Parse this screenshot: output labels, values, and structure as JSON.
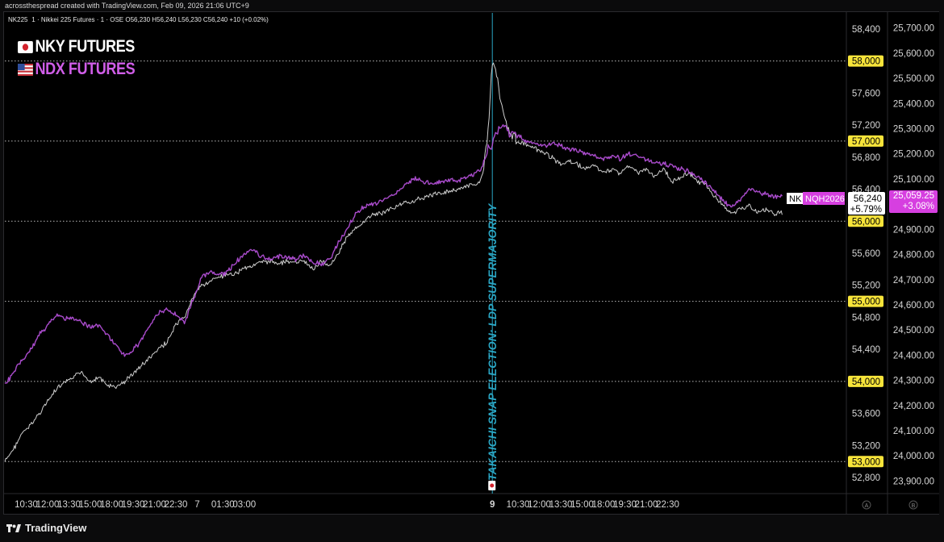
{
  "credit": "acrossthespread created with TradingView.com, Feb 09, 2026 21:06 UTC+9",
  "symbol_line": "NK2251 · Nikkei 225 Futures · 1 · OSE  O56,230  H56,240  L56,230  C56,240  +10 (+0.02%)",
  "legend": {
    "nky": "NKY FUTURES",
    "ndx": "NDX FUTURES"
  },
  "brand": "TradingView",
  "colors": {
    "nky": "#d8d8d8",
    "ndx": "#b24fd6",
    "label_yellow": "#f7e43a",
    "event_line": "#2aa6c4",
    "pink_badge": "#d63fe0"
  },
  "chart_data": {
    "type": "line",
    "title": "",
    "x_ticks": [
      "10:30",
      "12:00",
      "13:30",
      "15:00",
      "18:00",
      "19:30",
      "21:00",
      "22:30",
      "7",
      "01:30",
      "03:00",
      "9",
      "10:30",
      "12:00",
      "13:30",
      "15:00",
      "18:00",
      "19:30",
      "21:00",
      "22:30"
    ],
    "left_axis": {
      "ticks": [
        "58,400",
        "57,600",
        "57,200",
        "56,800",
        "56,400",
        "55,600",
        "55,200",
        "54,800",
        "54,400",
        "53,600",
        "53,200",
        "52,800"
      ],
      "highlighted": [
        "58,000",
        "57,000",
        "56,000",
        "55,000",
        "54,000",
        "53,000"
      ],
      "ylim": [
        52600,
        58600
      ]
    },
    "right_axis": {
      "ticks": [
        "25,700.00",
        "25,600.00",
        "25,500.00",
        "25,400.00",
        "25,300.00",
        "25,200.00",
        "25,100.00",
        "24,900.00",
        "24,800.00",
        "24,700.00",
        "24,600.00",
        "24,500.00",
        "24,400.00",
        "24,300.00",
        "24,200.00",
        "24,100.00",
        "24,000.00",
        "23,900.00"
      ],
      "ylim": [
        23850,
        25760
      ]
    },
    "annotation": "TAKAICHI SNAP ELECTION: LDP SUPERMAJORITY",
    "series": [
      {
        "name": "NKY FUTURES",
        "axis": "left",
        "points": [
          [
            0,
            53000
          ],
          [
            2,
            53150
          ],
          [
            4,
            53350
          ],
          [
            6,
            53450
          ],
          [
            8,
            53600
          ],
          [
            10,
            53750
          ],
          [
            12,
            53900
          ],
          [
            14,
            53980
          ],
          [
            16,
            54050
          ],
          [
            18,
            54120
          ],
          [
            20,
            54000
          ],
          [
            22,
            54050
          ],
          [
            24,
            53950
          ],
          [
            26,
            53920
          ],
          [
            28,
            54000
          ],
          [
            30,
            54100
          ],
          [
            32,
            54200
          ],
          [
            34,
            54300
          ],
          [
            36,
            54400
          ],
          [
            38,
            54500
          ],
          [
            40,
            54700
          ],
          [
            42,
            54800
          ],
          [
            44,
            55050
          ],
          [
            46,
            55200
          ],
          [
            48,
            55250
          ],
          [
            50,
            55300
          ],
          [
            52,
            55320
          ],
          [
            54,
            55350
          ],
          [
            56,
            55420
          ],
          [
            58,
            55450
          ],
          [
            60,
            55480
          ],
          [
            62,
            55500
          ],
          [
            64,
            55480
          ],
          [
            66,
            55500
          ],
          [
            68,
            55480
          ],
          [
            70,
            55500
          ],
          [
            72,
            55400
          ],
          [
            74,
            55500
          ],
          [
            76,
            55450
          ],
          [
            78,
            55600
          ],
          [
            80,
            55800
          ],
          [
            82,
            55900
          ],
          [
            84,
            56000
          ],
          [
            86,
            56080
          ],
          [
            88,
            56100
          ],
          [
            90,
            56150
          ],
          [
            92,
            56200
          ],
          [
            94,
            56230
          ],
          [
            96,
            56260
          ],
          [
            98,
            56300
          ],
          [
            100,
            56330
          ],
          [
            102,
            56350
          ],
          [
            104,
            56380
          ],
          [
            106,
            56400
          ],
          [
            108,
            56430
          ],
          [
            110,
            56460
          ],
          [
            111,
            56500
          ],
          [
            112,
            56650
          ],
          [
            113,
            57100
          ],
          [
            114,
            58000
          ],
          [
            115,
            57850
          ],
          [
            116,
            57500
          ],
          [
            117,
            57300
          ],
          [
            118,
            57100
          ],
          [
            120,
            57000
          ],
          [
            122,
            56950
          ],
          [
            124,
            56900
          ],
          [
            126,
            56850
          ],
          [
            128,
            56800
          ],
          [
            130,
            56700
          ],
          [
            132,
            56750
          ],
          [
            134,
            56700
          ],
          [
            136,
            56650
          ],
          [
            138,
            56700
          ],
          [
            140,
            56600
          ],
          [
            142,
            56650
          ],
          [
            144,
            56600
          ],
          [
            146,
            56700
          ],
          [
            148,
            56600
          ],
          [
            150,
            56650
          ],
          [
            152,
            56550
          ],
          [
            154,
            56650
          ],
          [
            156,
            56500
          ],
          [
            158,
            56550
          ],
          [
            160,
            56600
          ],
          [
            162,
            56500
          ],
          [
            164,
            56450
          ],
          [
            166,
            56300
          ],
          [
            168,
            56200
          ],
          [
            170,
            56100
          ],
          [
            172,
            56150
          ],
          [
            174,
            56200
          ],
          [
            176,
            56100
          ],
          [
            178,
            56150
          ],
          [
            180,
            56100
          ],
          [
            182,
            56100
          ]
        ]
      },
      {
        "name": "NDX FUTURES",
        "axis": "right",
        "points": [
          [
            0,
            24280
          ],
          [
            2,
            24330
          ],
          [
            4,
            24380
          ],
          [
            6,
            24420
          ],
          [
            8,
            24480
          ],
          [
            10,
            24520
          ],
          [
            12,
            24560
          ],
          [
            14,
            24550
          ],
          [
            16,
            24540
          ],
          [
            18,
            24530
          ],
          [
            20,
            24510
          ],
          [
            22,
            24520
          ],
          [
            24,
            24480
          ],
          [
            26,
            24440
          ],
          [
            28,
            24400
          ],
          [
            30,
            24420
          ],
          [
            32,
            24460
          ],
          [
            34,
            24520
          ],
          [
            36,
            24570
          ],
          [
            38,
            24580
          ],
          [
            40,
            24560
          ],
          [
            42,
            24530
          ],
          [
            44,
            24620
          ],
          [
            46,
            24710
          ],
          [
            48,
            24730
          ],
          [
            50,
            24720
          ],
          [
            52,
            24730
          ],
          [
            54,
            24770
          ],
          [
            56,
            24800
          ],
          [
            58,
            24820
          ],
          [
            60,
            24790
          ],
          [
            62,
            24780
          ],
          [
            64,
            24790
          ],
          [
            66,
            24790
          ],
          [
            68,
            24780
          ],
          [
            70,
            24800
          ],
          [
            72,
            24770
          ],
          [
            74,
            24760
          ],
          [
            76,
            24780
          ],
          [
            78,
            24850
          ],
          [
            80,
            24900
          ],
          [
            82,
            24960
          ],
          [
            84,
            24990
          ],
          [
            86,
            25000
          ],
          [
            88,
            25010
          ],
          [
            90,
            25030
          ],
          [
            92,
            25050
          ],
          [
            94,
            25080
          ],
          [
            96,
            25100
          ],
          [
            98,
            25090
          ],
          [
            100,
            25080
          ],
          [
            102,
            25090
          ],
          [
            104,
            25100
          ],
          [
            106,
            25090
          ],
          [
            108,
            25110
          ],
          [
            110,
            25120
          ],
          [
            111,
            25130
          ],
          [
            112,
            25160
          ],
          [
            113,
            25220
          ],
          [
            114,
            25250
          ],
          [
            115,
            25290
          ],
          [
            116,
            25300
          ],
          [
            117,
            25310
          ],
          [
            118,
            25290
          ],
          [
            120,
            25270
          ],
          [
            122,
            25250
          ],
          [
            124,
            25240
          ],
          [
            126,
            25230
          ],
          [
            128,
            25240
          ],
          [
            130,
            25230
          ],
          [
            132,
            25220
          ],
          [
            134,
            25210
          ],
          [
            136,
            25200
          ],
          [
            138,
            25190
          ],
          [
            140,
            25180
          ],
          [
            142,
            25190
          ],
          [
            144,
            25180
          ],
          [
            146,
            25200
          ],
          [
            148,
            25190
          ],
          [
            150,
            25180
          ],
          [
            152,
            25170
          ],
          [
            154,
            25160
          ],
          [
            156,
            25150
          ],
          [
            158,
            25140
          ],
          [
            160,
            25130
          ],
          [
            162,
            25110
          ],
          [
            164,
            25080
          ],
          [
            166,
            25050
          ],
          [
            168,
            25010
          ],
          [
            170,
            24990
          ],
          [
            172,
            25020
          ],
          [
            174,
            25060
          ],
          [
            176,
            25050
          ],
          [
            178,
            25040
          ],
          [
            180,
            25030
          ],
          [
            182,
            25030
          ]
        ]
      }
    ],
    "price_labels": {
      "nky_symbol": "NK",
      "nky_last": "56,240",
      "nky_change": "+5.79%",
      "ndx_symbol": "NQH2026",
      "ndx_last": "25,059.25",
      "ndx_change": "+3.08%"
    },
    "axis_badges": [
      "A",
      "B"
    ]
  }
}
